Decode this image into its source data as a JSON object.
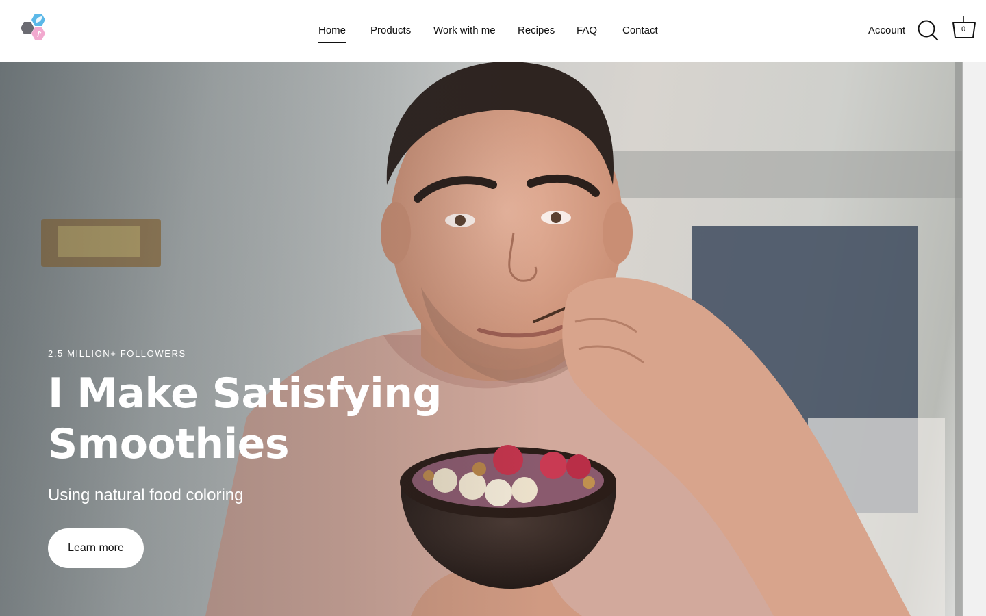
{
  "header": {
    "logo_icon": "hexagon-leaf-logo-icon",
    "nav": [
      {
        "label": "Home",
        "active": true
      },
      {
        "label": "Products",
        "active": false
      },
      {
        "label": "Work with me",
        "active": false
      },
      {
        "label": "Recipes",
        "active": false
      },
      {
        "label": "FAQ",
        "active": false
      },
      {
        "label": "Contact",
        "active": false
      }
    ],
    "account_label": "Account",
    "search_icon": "search-icon",
    "cart_icon": "cart-basket-icon",
    "cart_count": "0"
  },
  "hero": {
    "eyebrow": "2.5 MILLION+ FOLLOWERS",
    "headline": "I Make Satisfying Smoothies",
    "subhead": "Using natural food coloring",
    "cta_label": "Learn more"
  },
  "colors": {
    "text": "#111111",
    "header_bg": "#ffffff",
    "logo_blue": "#5bb8e8",
    "logo_pink": "#f2a9cf",
    "logo_gray": "#6b6b72",
    "hero_text": "#ffffff"
  }
}
